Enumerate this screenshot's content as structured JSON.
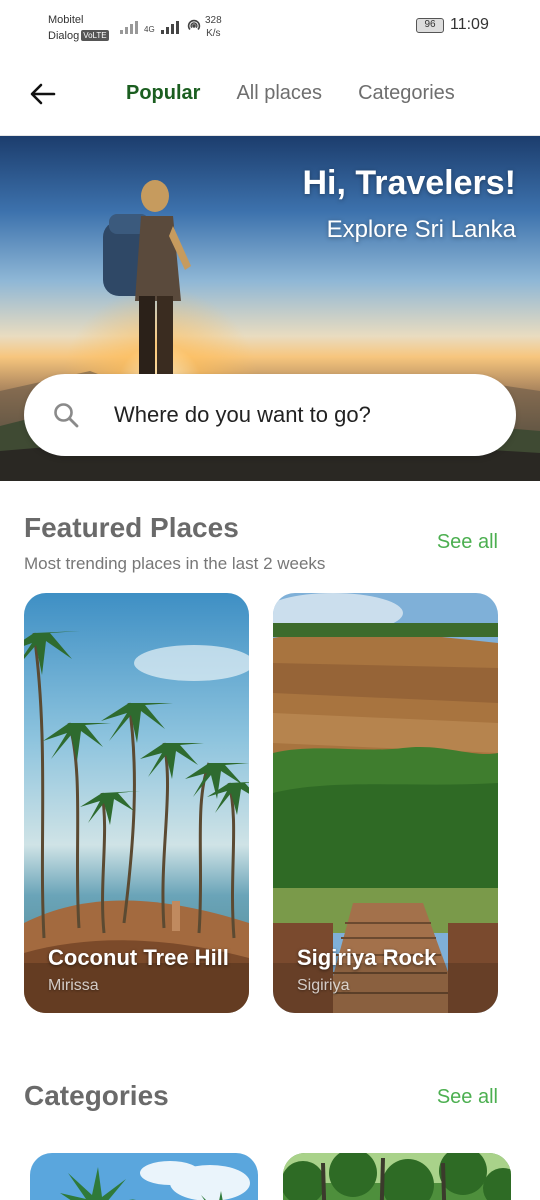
{
  "status_bar": {
    "carrier_1": "Mobitel",
    "carrier_2": "Dialog",
    "volte_badge": "VoLTE",
    "network_type": "4G",
    "speed_value": "328",
    "speed_unit": "K/s",
    "battery_level": "96",
    "time": "11:09"
  },
  "app_bar": {
    "back_icon": "arrow-left-icon",
    "tabs": [
      {
        "label": "Popular",
        "active": true
      },
      {
        "label": "All places",
        "active": false
      },
      {
        "label": "Categories",
        "active": false
      }
    ]
  },
  "hero": {
    "title": "Hi, Travelers!",
    "subtitle": "Explore Sri Lanka",
    "search": {
      "icon": "search-icon",
      "placeholder": "Where do you want to go?"
    }
  },
  "featured": {
    "title": "Featured Places",
    "subtitle": "Most trending places in the last 2 weeks",
    "see_all_label": "See all",
    "places": [
      {
        "name": "Coconut Tree Hill",
        "location": "Mirissa"
      },
      {
        "name": "Sigiriya Rock",
        "location": "Sigiriya"
      }
    ]
  },
  "categories": {
    "title": "Categories",
    "see_all_label": "See all"
  },
  "colors": {
    "accent_green": "#4caf50",
    "active_tab_green": "#1b5e20",
    "section_title_gray": "#6a6a6a"
  }
}
